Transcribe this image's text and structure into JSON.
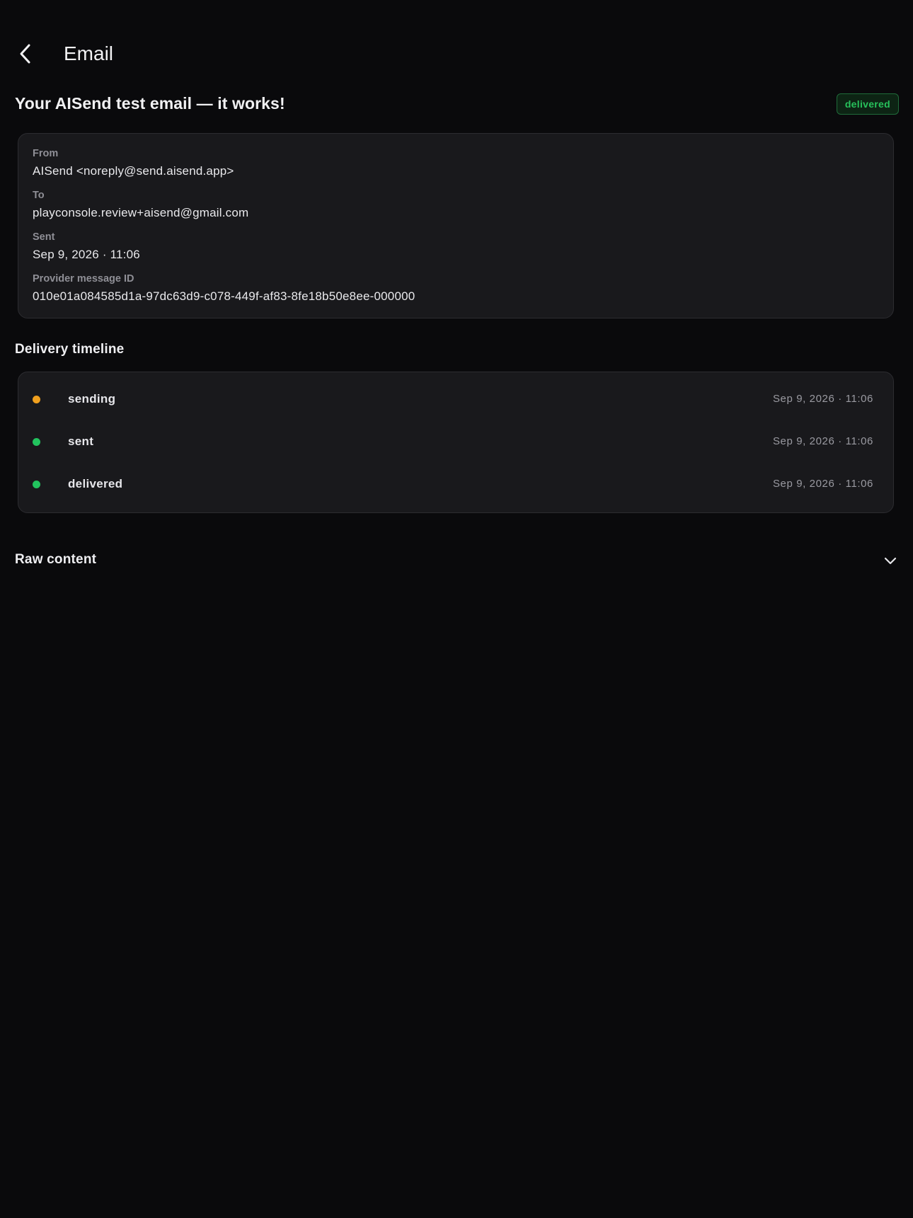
{
  "appbar": {
    "title": "Email"
  },
  "email": {
    "subject": "Your AISend test email — it works!",
    "status": "delivered",
    "details": {
      "from_label": "From",
      "from_value": "AISend <noreply@send.aisend.app>",
      "to_label": "To",
      "to_value": "playconsole.review+aisend@gmail.com",
      "sent_label": "Sent",
      "sent_value": "Sep 9, 2026 · 11:06",
      "msgid_label": "Provider message ID",
      "msgid_value": "010e01a084585d1a-97dc63d9-c078-449f-af83-8fe18b50e8ee-000000"
    }
  },
  "timeline": {
    "heading": "Delivery timeline",
    "events": [
      {
        "label": "sending",
        "time": "Sep 9, 2026 · 11:06",
        "color": "#f0a01e"
      },
      {
        "label": "sent",
        "time": "Sep 9, 2026 · 11:06",
        "color": "#22c35e"
      },
      {
        "label": "delivered",
        "time": "Sep 9, 2026 · 11:06",
        "color": "#22c35e"
      }
    ]
  },
  "raw": {
    "heading": "Raw content"
  },
  "colors": {
    "background": "#0a0a0c",
    "card": "#19191c",
    "accent_green": "#27c25b",
    "accent_orange": "#f0a01e"
  }
}
